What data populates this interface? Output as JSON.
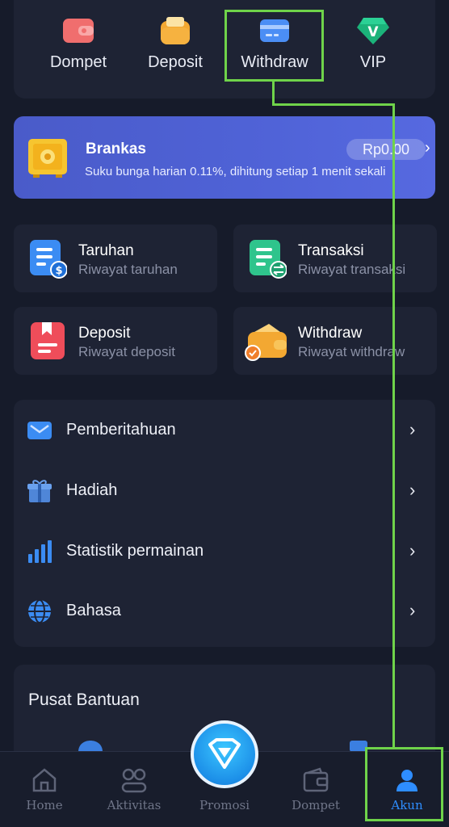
{
  "quick_actions": [
    {
      "label": "Dompet",
      "icon": "wallet-icon"
    },
    {
      "label": "Deposit",
      "icon": "deposit-icon"
    },
    {
      "label": "Withdraw",
      "icon": "card-icon"
    },
    {
      "label": "VIP",
      "icon": "vip-badge-icon"
    }
  ],
  "brankas": {
    "title": "Brankas",
    "subtitle": "Suku bunga harian 0.11%, dihitung setiap 1 menit sekali",
    "balance": "Rp0.00",
    "icon": "safe-icon"
  },
  "history_cards": [
    {
      "title": "Taruhan",
      "subtitle": "Riwayat taruhan",
      "icon": "bet-history-icon"
    },
    {
      "title": "Transaksi",
      "subtitle": "Riwayat transaksi",
      "icon": "transaction-history-icon"
    },
    {
      "title": "Deposit",
      "subtitle": "Riwayat deposit",
      "icon": "deposit-history-icon"
    },
    {
      "title": "Withdraw",
      "subtitle": "Riwayat withdraw",
      "icon": "withdraw-history-icon"
    }
  ],
  "menu": [
    {
      "label": "Pemberitahuan",
      "icon": "mail-icon"
    },
    {
      "label": "Hadiah",
      "icon": "gift-icon"
    },
    {
      "label": "Statistik permainan",
      "icon": "bar-chart-icon"
    },
    {
      "label": "Bahasa",
      "icon": "globe-icon"
    }
  ],
  "help": {
    "title": "Pusat Bantuan"
  },
  "tabbar": [
    {
      "label": "Home",
      "icon": "home-icon"
    },
    {
      "label": "Aktivitas",
      "icon": "activity-icon"
    },
    {
      "label": "Promosi",
      "icon": "diamond-icon"
    },
    {
      "label": "Dompet",
      "icon": "wallet-icon"
    },
    {
      "label": "Akun",
      "icon": "user-icon",
      "active": true
    }
  ],
  "colors": {
    "background": "#161b2a",
    "card": "#1e2334",
    "accent": "#2e8dff",
    "highlight": "#6fd34a",
    "brankas": "#4f62d6"
  }
}
